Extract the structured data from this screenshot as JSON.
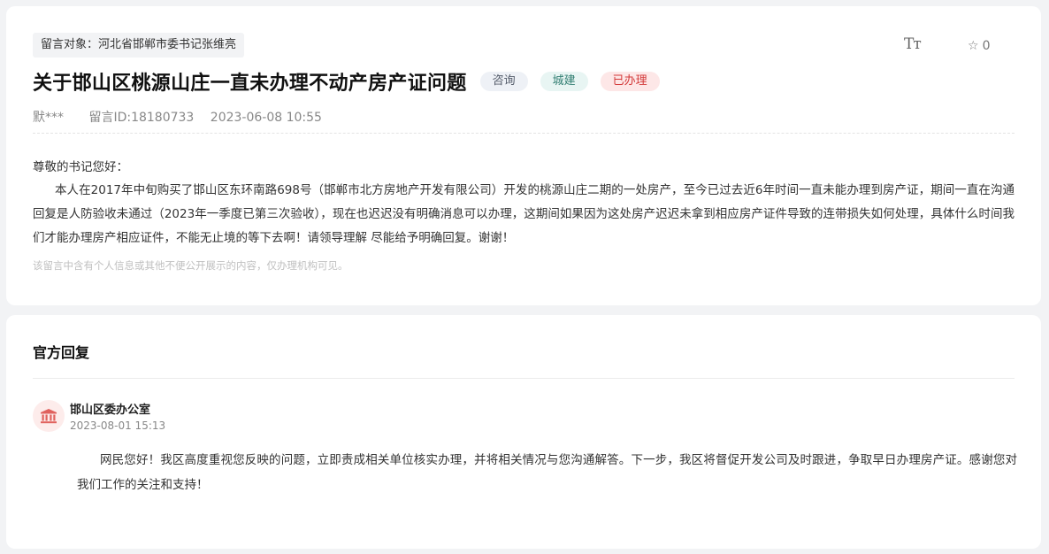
{
  "message": {
    "target": "留言对象：河北省邯郸市委书记张维亮",
    "tools": {
      "font_size_icon": "Tт",
      "favorite_count": "0"
    },
    "title": "关于邯山区桃源山庄一直未办理不动产房产证问题",
    "tags": [
      "咨询",
      "城建",
      "已办理"
    ],
    "author": "默***",
    "id_label": "留言ID:18180733",
    "datetime": "2023-06-08 10:55",
    "greeting": "尊敬的书记您好：",
    "content": "本人在2017年中旬购买了邯山区东环南路698号（邯郸市北方房地产开发有限公司）开发的桃源山庄二期的一处房产，至今已过去近6年时间一直未能办理到房产证，期间一直在沟通回复是人防验收未通过（2023年一季度已第三次验收），现在也迟迟没有明确消息可以办理，这期间如果因为这处房产迟迟未拿到相应房产证件导致的连带损失如何处理，具体什么时间我们才能办理房产相应证件，不能无止境的等下去啊！请领导理解 尽能给予明确回复。谢谢！",
    "privacy_note": "该留言中含有个人信息或其他不便公开展示的内容，仅办理机构可见。"
  },
  "reply": {
    "section_title": "官方回复",
    "org_name": "邯山区委办公室",
    "datetime": "2023-08-01 15:13",
    "content": "网民您好！我区高度重视您反映的问题，立即责成相关单位核实办理，并将相关情况与您沟通解答。下一步，我区将督促开发公司及时跟进，争取早日办理房产证。感谢您对我们工作的关注和支持！"
  },
  "icons": {
    "font_size": "font-size-icon",
    "favorite": "star-icon",
    "org": "government-building-icon"
  },
  "colors": {
    "done_tag": "#d33a3a",
    "city_tag": "#337f73",
    "consult_tag": "#555d6b"
  }
}
